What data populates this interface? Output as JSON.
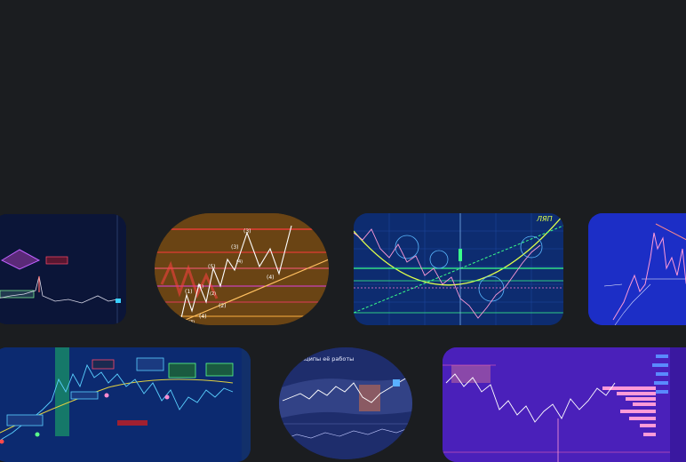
{
  "colors": {
    "page_background": "#1b1d20"
  },
  "cards": {
    "elliott": {
      "labels": [
        "(3)",
        "(5)",
        "(3)",
        "(1)",
        "(4)",
        "(1)",
        "(2)",
        "(4)",
        "(3)",
        "(2)",
        "(4)"
      ]
    },
    "cup": {
      "corner_label": "ЛЯП"
    },
    "oval": {
      "title": "и принципы её работы"
    }
  }
}
